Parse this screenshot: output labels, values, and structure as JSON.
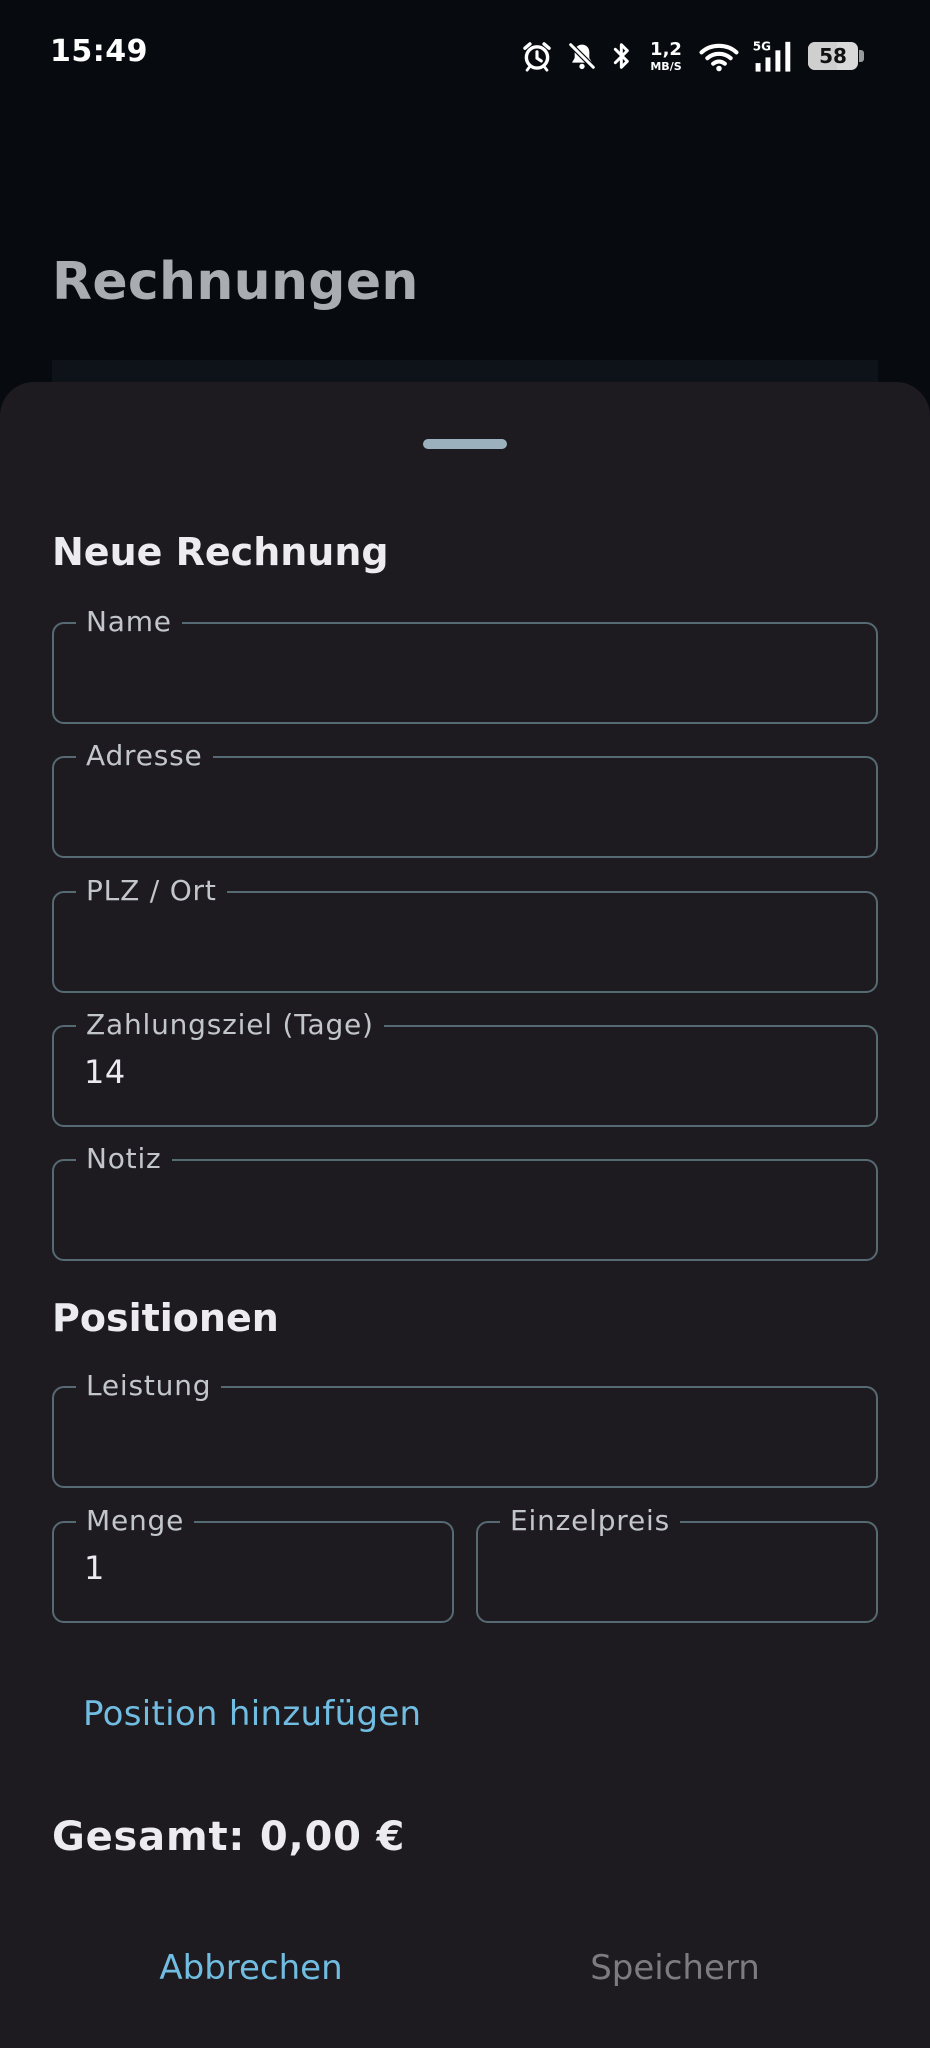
{
  "status_bar": {
    "time": "15:49",
    "net_speed_value": "1,2",
    "net_speed_unit": "MB/S",
    "network_type": "5G",
    "battery_level": "58"
  },
  "background": {
    "title": "Rechnungen"
  },
  "sheet": {
    "title": "Neue Rechnung",
    "fields": {
      "name": {
        "label": "Name",
        "value": ""
      },
      "address": {
        "label": "Adresse",
        "value": ""
      },
      "zip_city": {
        "label": "PLZ / Ort",
        "value": ""
      },
      "payment_term": {
        "label": "Zahlungsziel (Tage)",
        "value": "14"
      },
      "note": {
        "label": "Notiz",
        "value": ""
      }
    },
    "positions_title": "Positionen",
    "position_fields": {
      "service": {
        "label": "Leistung",
        "value": ""
      },
      "quantity": {
        "label": "Menge",
        "value": "1"
      },
      "unit_price": {
        "label": "Einzelpreis",
        "value": ""
      }
    },
    "add_position_label": "Position hinzufügen",
    "total_label": "Gesamt: 0,00 €",
    "cancel_label": "Abbrechen",
    "save_label": "Speichern"
  },
  "colors": {
    "sheet_background": "#1e1b20",
    "field_outline": "#566a73",
    "accent": "#71bde1",
    "disabled_text": "#7d7a80",
    "drag_handle": "#9bb2be"
  }
}
